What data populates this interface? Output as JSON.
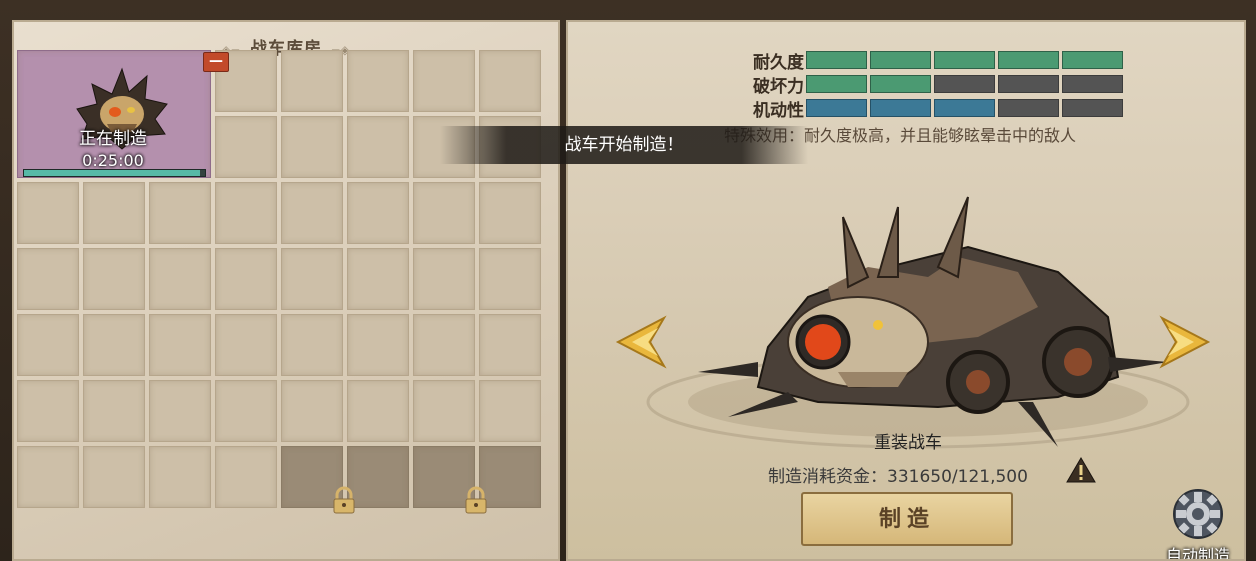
{
  "garage": {
    "title": "战车库房",
    "building_item": {
      "status_label": "正在制造",
      "timer": "0:25:00",
      "progress": 0.97,
      "badge": "—"
    }
  },
  "toast": {
    "message": "战车开始制造！"
  },
  "vehicle": {
    "stats": [
      {
        "label": "耐久度",
        "filled": 5,
        "total": 5,
        "color": "green"
      },
      {
        "label": "破坏力",
        "filled": 2,
        "total": 5,
        "color": "green"
      },
      {
        "label": "机动性",
        "filled": 3,
        "total": 5,
        "color": "blue"
      }
    ],
    "special_effect": "特殊效用：耐久度极高，并且能够眩晕击中的敌人",
    "name": "重装战车",
    "cost_label": "制造消耗资金：331650/121,500",
    "craft_button": "制造",
    "auto_craft_label": "自动制造"
  },
  "colors": {
    "stat_green": "#4b9a72",
    "stat_blue": "#3c7996",
    "progress": "#57b9a7",
    "badge": "#c24a2a"
  }
}
